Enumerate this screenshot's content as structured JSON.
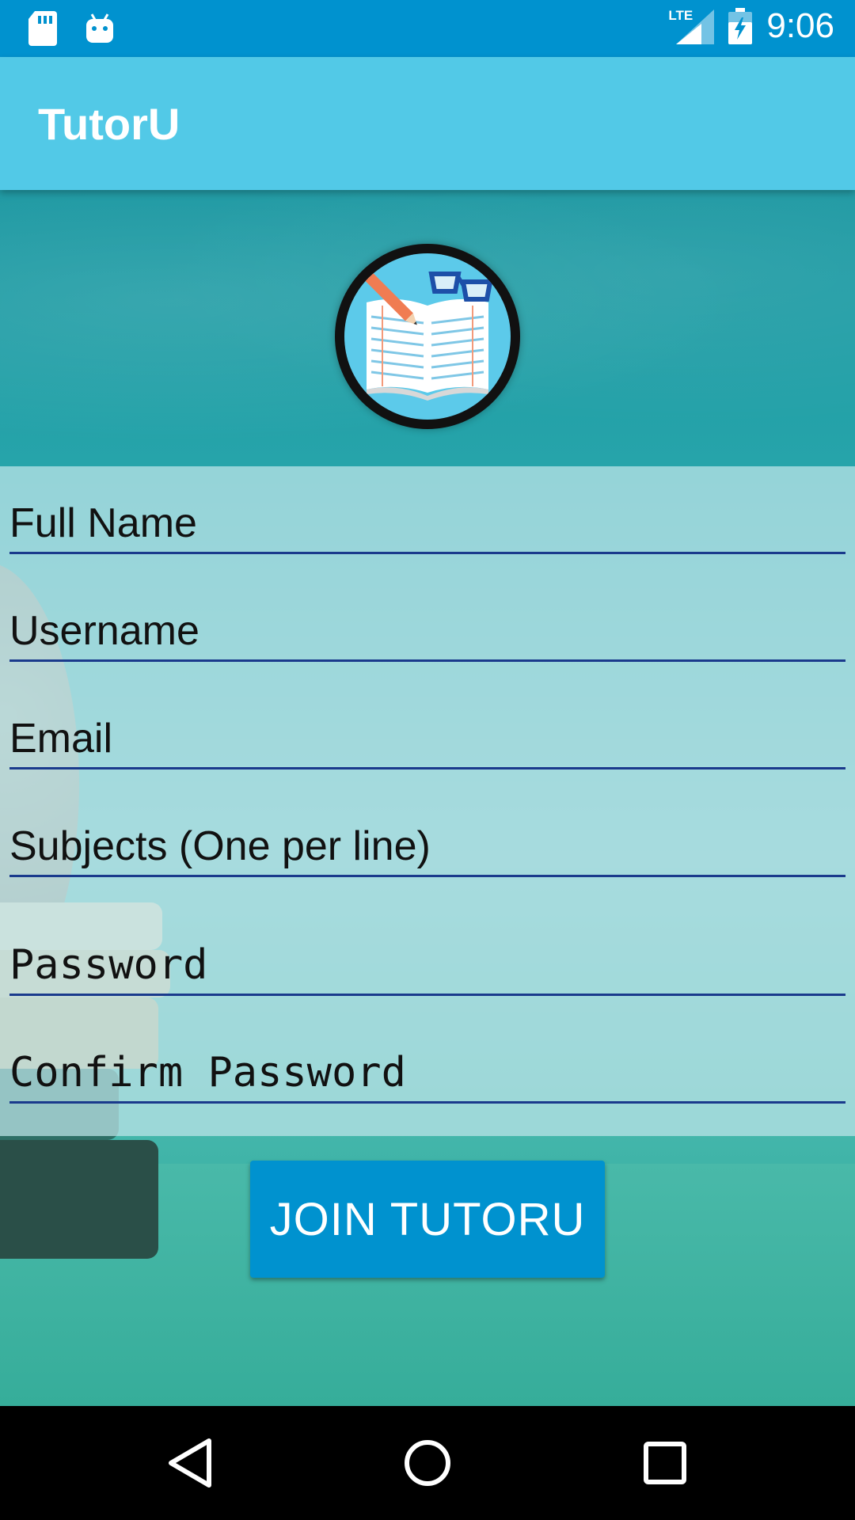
{
  "status_bar": {
    "time": "9:06",
    "network": "LTE",
    "icons": [
      "sd-card-icon",
      "android-icon",
      "lte-signal-icon",
      "battery-charging-icon"
    ]
  },
  "app_bar": {
    "title": "TutorU"
  },
  "logo": {
    "icon": "book-pencil-glasses-logo"
  },
  "form": {
    "full_name_placeholder": "Full Name",
    "username_placeholder": "Username",
    "email_placeholder": "Email",
    "subjects_placeholder": "Subjects (One per line)",
    "password_placeholder": "Password",
    "confirm_password_placeholder": "Confirm Password"
  },
  "join_button": {
    "label": "JOIN TUTORU"
  },
  "nav_bar": {
    "icons": [
      "back-icon",
      "home-icon",
      "recents-icon"
    ]
  },
  "colors": {
    "status_bar": "#0092cf",
    "app_bar": "#52c9e7",
    "button": "#0092cf",
    "field_underline": "#1a3a8c"
  }
}
